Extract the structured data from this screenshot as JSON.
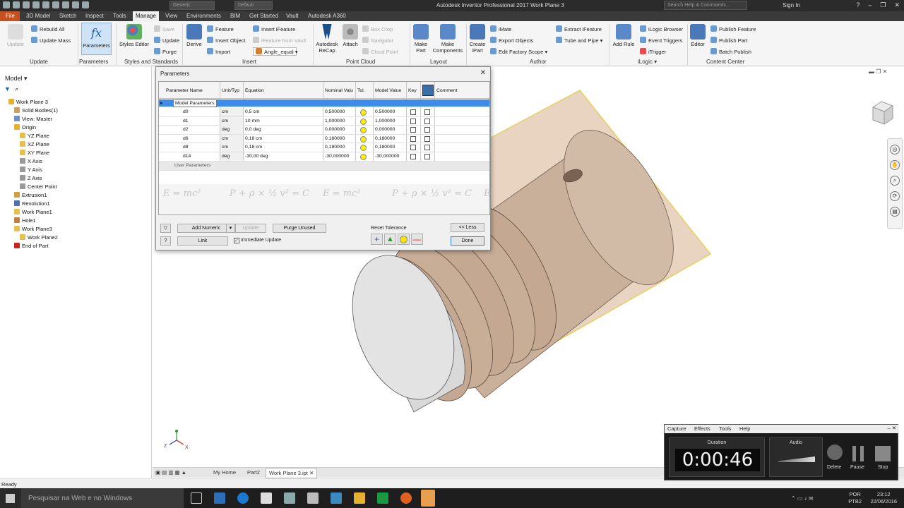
{
  "titlebar": {
    "appearance_combo": "Generic",
    "default_combo": "Default",
    "title": "Autodesk Inventor Professional 2017    Work Plane 3",
    "search_placeholder": "Search Help & Commands...",
    "signin": "Sign In"
  },
  "tabs": [
    {
      "label": "File"
    },
    {
      "label": "3D Model"
    },
    {
      "label": "Sketch"
    },
    {
      "label": "Inspect"
    },
    {
      "label": "Tools"
    },
    {
      "label": "Manage"
    },
    {
      "label": "View"
    },
    {
      "label": "Environments"
    },
    {
      "label": "BIM"
    },
    {
      "label": "Get Started"
    },
    {
      "label": "Vault"
    },
    {
      "label": "Autodesk A360"
    }
  ],
  "ribbon": {
    "update": {
      "update": "Update",
      "rebuild_all": "Rebuild All",
      "update_mass": "Update Mass",
      "group": "Update"
    },
    "parameters": {
      "parameters": "Parameters",
      "group": "Parameters"
    },
    "styles": {
      "styles_editor": "Styles Editor",
      "save": "Save",
      "update": "Update",
      "purge": "Purge",
      "group": "Styles and Standards"
    },
    "insert": {
      "derive": "Derive",
      "feature": "Feature",
      "insert_object": "Insert Object",
      "import": "Import",
      "insert_ifeature": "Insert iFeature",
      "ifeature_from_vault": "iFeature from Vault",
      "angle_equal": "Angle_equal",
      "group": "Insert"
    },
    "point_cloud": {
      "recap_line1": "Autodesk",
      "recap_line2": "ReCap",
      "attach": "Attach",
      "box_crop": "Box Crop",
      "navigator": "Navigator",
      "cloud_point": "Cloud Point",
      "group": "Point Cloud"
    },
    "layout": {
      "make_part_1": "Make",
      "make_part_2": "Part",
      "make_components_1": "Make",
      "make_components_2": "Components",
      "group": "Layout"
    },
    "author": {
      "create_ipart_1": "Create",
      "create_ipart_2": "iPart",
      "imate": "iMate",
      "export_objects": "Export Objects",
      "edit_factory_scope": "Edit Factory Scope",
      "extract_ifeature": "Extract iFeature",
      "tube_and_pipe": "Tube and Pipe",
      "group": "Author"
    },
    "ilogic": {
      "add_rule": "Add Rule",
      "ilogic_browser": "iLogic Browser",
      "event_triggers": "Event Triggers",
      "itrigger": "iTrigger",
      "group": "iLogic"
    },
    "content_center": {
      "editor": "Editor",
      "publish_feature": "Publish Feature",
      "publish_part": "Publish Part",
      "batch_publish": "Batch Publish",
      "group": "Content Center"
    }
  },
  "browser": {
    "header": "Model",
    "items": [
      {
        "label": "Work Plane 3",
        "color": "#e8b030"
      },
      {
        "label": "Solid Bodies(1)",
        "color": "#c9a060"
      },
      {
        "label": "View: Master",
        "color": "#7090c0"
      },
      {
        "label": "Origin",
        "color": "#e8b030"
      },
      {
        "label": "YZ Plane",
        "color": "#e8c050"
      },
      {
        "label": "XZ Plane",
        "color": "#e8c050"
      },
      {
        "label": "XY Plane",
        "color": "#e8c050"
      },
      {
        "label": "X Axis",
        "color": "#999999"
      },
      {
        "label": "Y Axis",
        "color": "#999999"
      },
      {
        "label": "Z Axis",
        "color": "#999999"
      },
      {
        "label": "Center Point",
        "color": "#999999"
      },
      {
        "label": "Extrusion1",
        "color": "#d0a040"
      },
      {
        "label": "Revolution1",
        "color": "#5070b0"
      },
      {
        "label": "Work Plane1",
        "color": "#e8c050"
      },
      {
        "label": "Hole1",
        "color": "#c08040"
      },
      {
        "label": "Work Plane3",
        "color": "#e8c050"
      },
      {
        "label": "Work Plane2",
        "color": "#e8c050"
      },
      {
        "label": "End of Part",
        "color": "#cc2222"
      }
    ]
  },
  "dialog": {
    "title": "Parameters",
    "columns": [
      "Parameter Name",
      "Unit/Typ",
      "Equation",
      "Nominal Valu",
      "Tol.",
      "Model Value",
      "Key",
      "",
      "Comment"
    ],
    "group_model": "Model Parameters",
    "group_user": "User Parameters",
    "rows": [
      {
        "name": "d0",
        "unit": "cm",
        "equation": "0,5 cm",
        "nominal": "0,500000",
        "model": "0,500000"
      },
      {
        "name": "d1",
        "unit": "cm",
        "equation": "10 mm",
        "nominal": "1,000000",
        "model": "1,000000"
      },
      {
        "name": "d2",
        "unit": "deg",
        "equation": "0,0 deg",
        "nominal": "0,000000",
        "model": "0,000000"
      },
      {
        "name": "d6",
        "unit": "cm",
        "equation": "0,18 cm",
        "nominal": "0,180000",
        "model": "0,180000"
      },
      {
        "name": "d8",
        "unit": "cm",
        "equation": "0,18 cm",
        "nominal": "0,180000",
        "model": "0,180000"
      },
      {
        "name": "d14",
        "unit": "deg",
        "equation": "-30,00 deg",
        "nominal": "-30,000000",
        "model": "-30,000000"
      }
    ],
    "add_numeric": "Add Numeric",
    "update": "Update",
    "purge_unused": "Purge Unused",
    "link": "Link",
    "immediate_update": "Immediate Update",
    "reset_tolerance": "Reset Tolerance",
    "less": "<< Less",
    "done": "Done"
  },
  "doctabs": {
    "my_home": "My Home",
    "part2": "Part2",
    "active": "Work Plane 3.ipt"
  },
  "status": "Ready",
  "recorder": {
    "menu": [
      "Capture",
      "Effects",
      "Tools",
      "Help"
    ],
    "duration_label": "Duration",
    "duration": "0:00:46",
    "audio_label": "Audio",
    "delete": "Delete",
    "pause": "Pause",
    "stop": "Stop"
  },
  "taskbar": {
    "search": "Pesquisar na Web e no Windows",
    "lang1": "POR",
    "lang2": "PTB2",
    "time": "23:12",
    "date": "22/06/2016"
  },
  "colors": {
    "accent": "#c8501e",
    "selection": "#3c8ce8",
    "part": "#c9b09a",
    "workplane": "#e8d4c0"
  }
}
